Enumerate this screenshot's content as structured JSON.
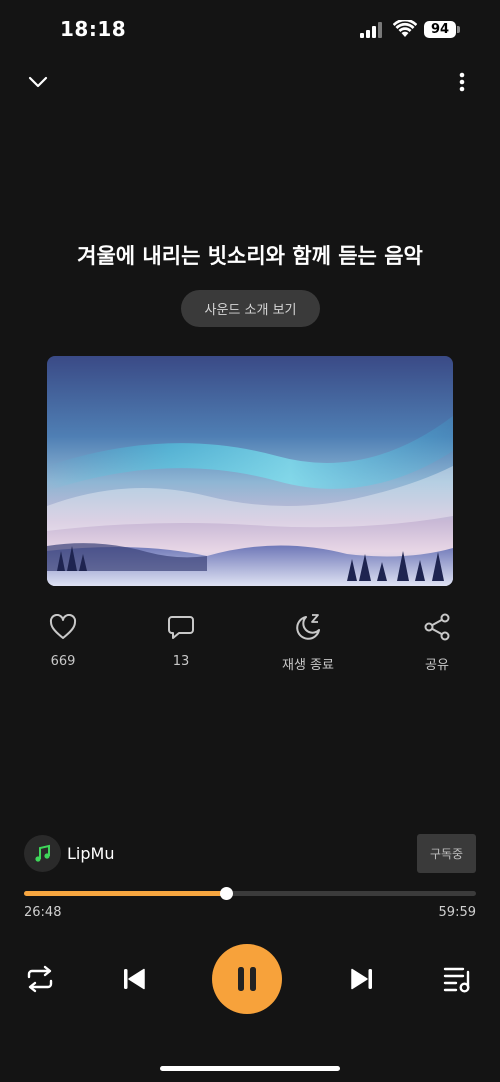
{
  "status": {
    "time": "18:18",
    "battery": "94"
  },
  "track": {
    "title": "겨울에 내리는 빗소리와 함께 듣는 음악",
    "intro_label": "사운드 소개 보기"
  },
  "actions": {
    "like_count": "669",
    "comment_count": "13",
    "sleep_label": "재생 종료",
    "share_label": "공유"
  },
  "channel": {
    "name": "LipMu",
    "subscribe_label": "구독중"
  },
  "playback": {
    "elapsed": "26:48",
    "total": "59:59",
    "progress": 0.447
  },
  "colors": {
    "accent": "#f7a23b",
    "background": "#141414"
  },
  "icons": [
    "chevron-down-icon",
    "more-vertical-icon",
    "heart-icon",
    "comment-icon",
    "sleep-timer-icon",
    "share-icon",
    "repeat-icon",
    "previous-icon",
    "pause-icon",
    "next-icon",
    "playlist-icon"
  ]
}
